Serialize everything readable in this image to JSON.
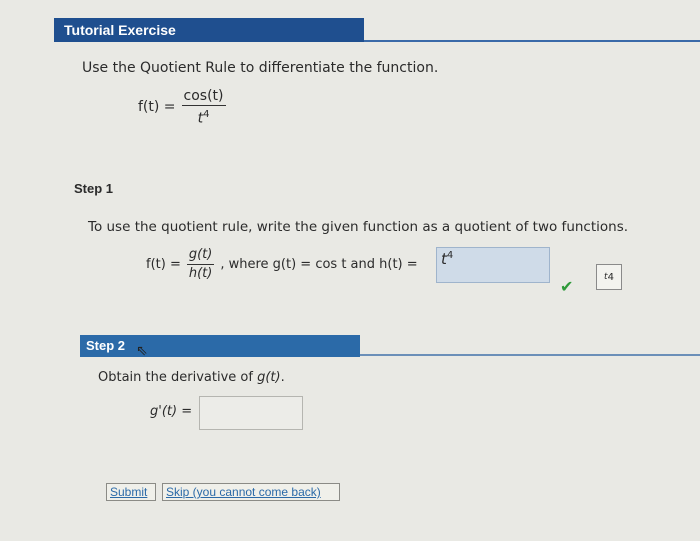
{
  "header": {
    "title": "Tutorial Exercise"
  },
  "instructions": "Use the Quotient Rule to differentiate the function.",
  "function": {
    "lhs": "f(t) =",
    "numerator": "cos(t)",
    "denominator_base": "t",
    "denominator_exp": "4"
  },
  "step1": {
    "label": "Step 1",
    "text": "To use the quotient rule, write the given function as a quotient of two functions.",
    "eq_lhs": "f(t) =",
    "eq_num": "g(t)",
    "eq_den": "h(t)",
    "eq_mid": ", where g(t) = cos t and h(t) =",
    "answer_base": "t",
    "answer_exp": "4",
    "hint_base": "t",
    "hint_exp": "4"
  },
  "step2": {
    "label": "Step 2",
    "text_pre": "Obtain the derivative of ",
    "text_fn": "g(t)",
    "text_post": ".",
    "gprime_label": "g'(t) =",
    "gprime_value": ""
  },
  "buttons": {
    "submit": "Submit",
    "skip": "Skip (you cannot come back)"
  },
  "colors": {
    "header": "#1f4f8f",
    "step_bar": "#2b6aa8",
    "answer_bg": "#cfdbe8",
    "check": "#2f9a3a"
  }
}
